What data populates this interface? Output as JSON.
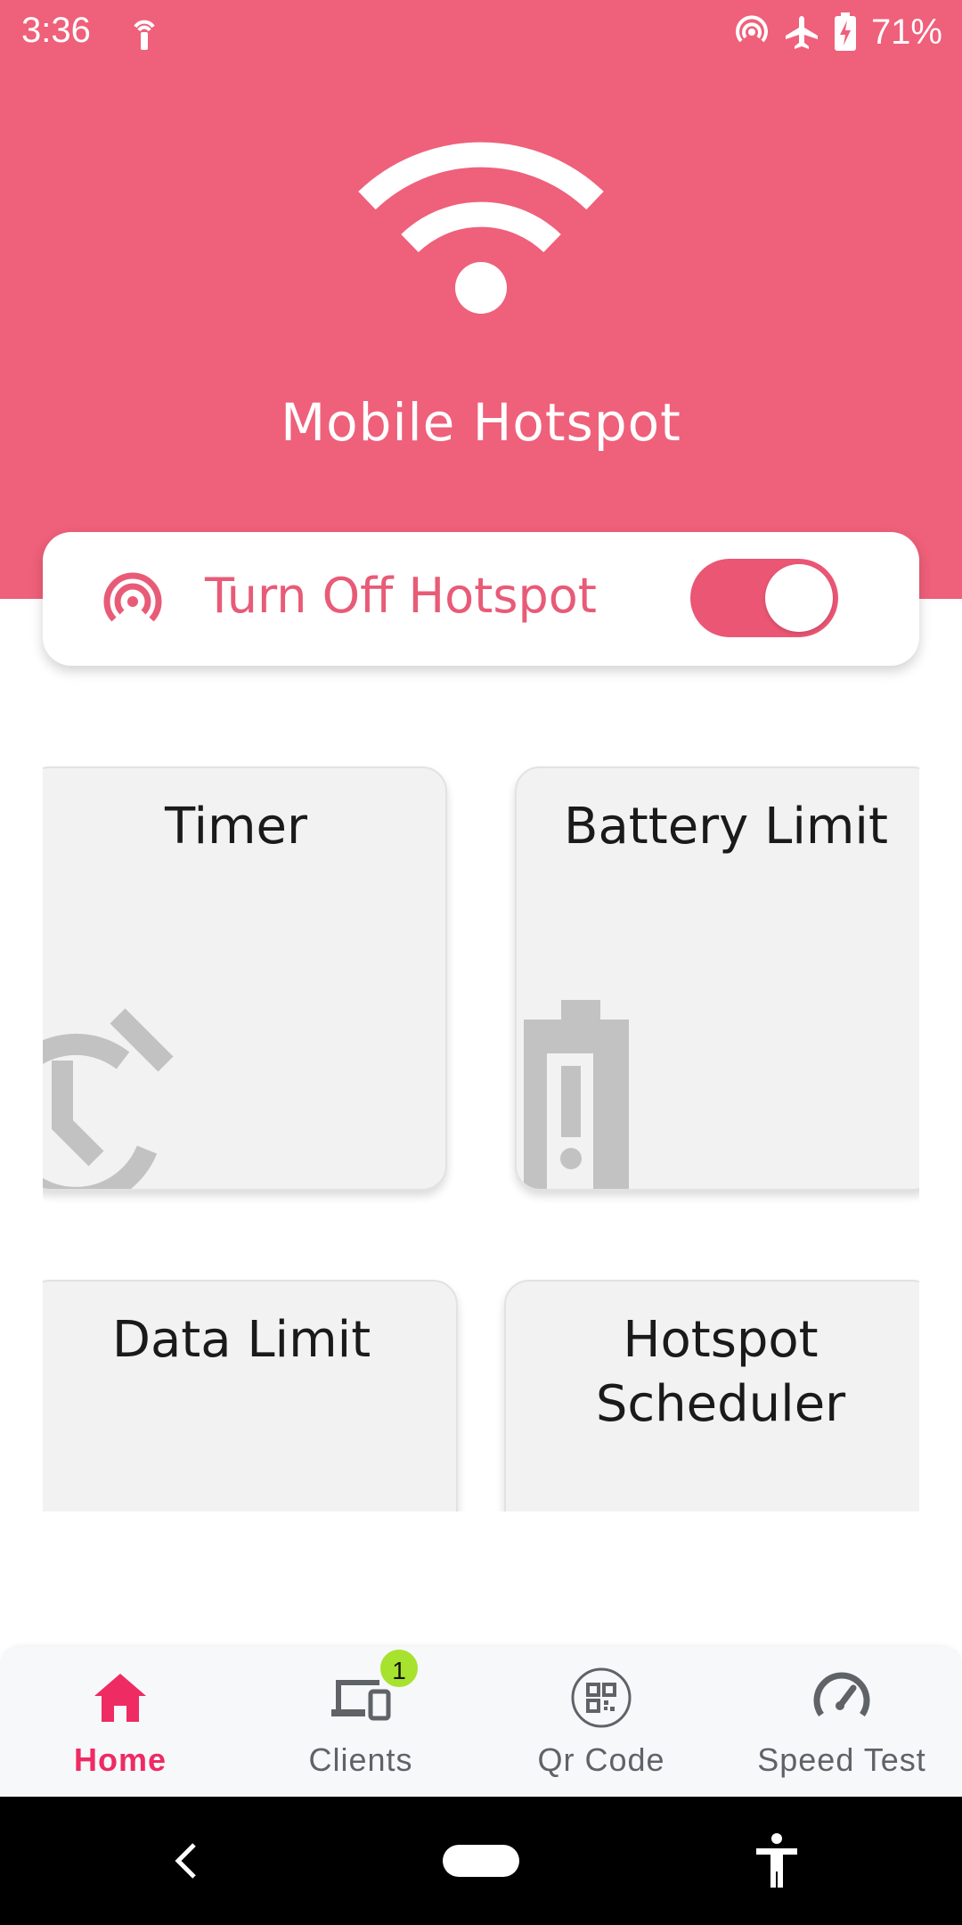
{
  "status_bar": {
    "time": "3:36",
    "battery_percent": "71%",
    "icons": [
      "tower-icon",
      "hotspot-icon",
      "airplane-icon",
      "battery-charging-icon"
    ]
  },
  "header": {
    "title": "Mobile Hotspot",
    "icon": "wifi-icon",
    "background_color": "#ef607a"
  },
  "hotspot_toggle": {
    "label": "Turn Off Hotspot",
    "icon": "hotspot-icon",
    "state": "on",
    "accent_color": "#ea5674"
  },
  "tiles": [
    {
      "title": "Timer",
      "icon": "stopwatch-icon"
    },
    {
      "title": "Battery Limit",
      "icon": "battery-alert-icon"
    },
    {
      "title": "Data Limit",
      "icon": "data-usage-icon"
    },
    {
      "title": "Hotspot Scheduler",
      "icon": "scheduler-icon"
    }
  ],
  "bottom_nav": {
    "items": [
      {
        "label": "Home",
        "icon": "home-icon",
        "active": true
      },
      {
        "label": "Clients",
        "icon": "devices-icon",
        "active": false,
        "badge": "1"
      },
      {
        "label": "Qr Code",
        "icon": "qr-code-icon",
        "active": false
      },
      {
        "label": "Speed Test",
        "icon": "speedometer-icon",
        "active": false
      }
    ],
    "active_color": "#ee2b63"
  },
  "system_nav": {
    "icons": [
      "back-icon",
      "home-pill",
      "accessibility-icon"
    ]
  }
}
